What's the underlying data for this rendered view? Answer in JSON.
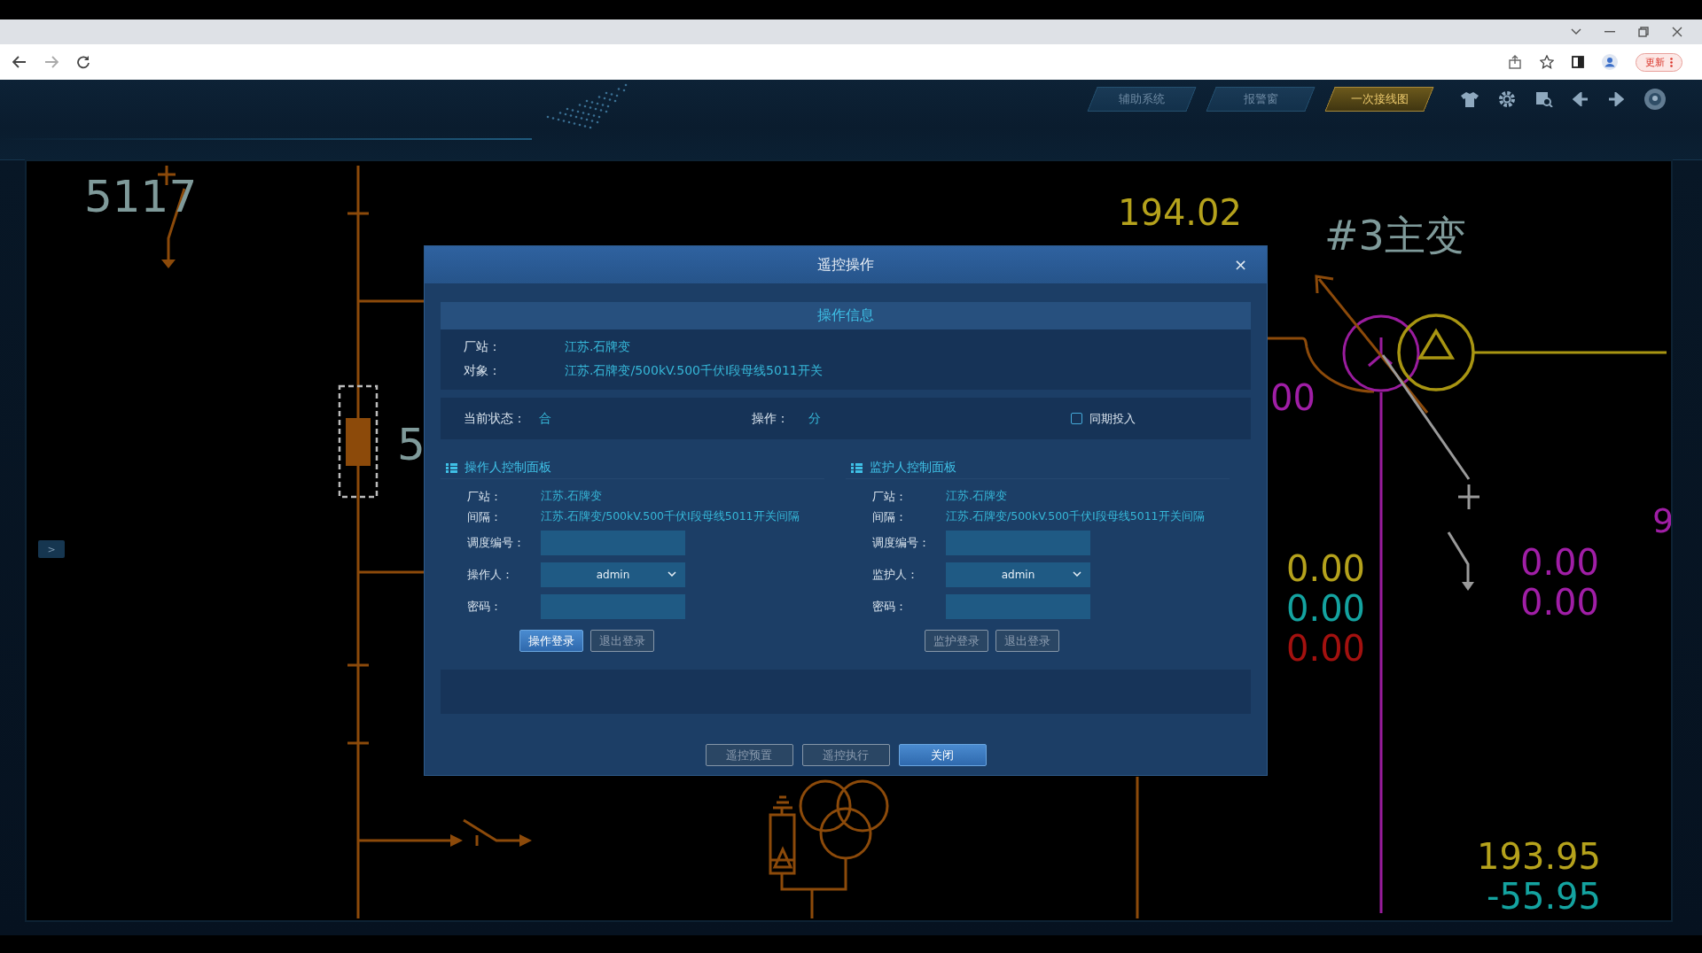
{
  "browser": {
    "update_button": "更新"
  },
  "header": {
    "tabs": [
      {
        "label": "辅助系统",
        "selected": false
      },
      {
        "label": "报警窗",
        "selected": false
      },
      {
        "label": "一次接线图",
        "selected": true
      }
    ]
  },
  "sidebar_toggle": ">",
  "diagram": {
    "labels": [
      {
        "text": "5117",
        "color": "#7f9a9a"
      },
      {
        "text": "5",
        "color": "#7f9a9a"
      },
      {
        "text": "194.02",
        "color": "#b5a21c"
      },
      {
        "text": "#3主变",
        "color": "#7f9a9a"
      },
      {
        "text": "00",
        "color": "#a01ea6"
      },
      {
        "text": "9",
        "color": "#a01ea6"
      },
      {
        "text": "0.00",
        "color": "#b5a21c"
      },
      {
        "text": "0.00",
        "color": "#14a3a0"
      },
      {
        "text": "0.00",
        "color": "#a3110f"
      },
      {
        "text": "0.00",
        "color": "#a01ea6"
      },
      {
        "text": "0.00",
        "color": "#a01ea6"
      },
      {
        "text": "193.95",
        "color": "#b5a21c"
      },
      {
        "text": "-55.95",
        "color": "#14a3a0"
      }
    ]
  },
  "dialog": {
    "title": "遥控操作",
    "close": "×",
    "info": {
      "heading": "操作信息",
      "fields": [
        {
          "label": "厂站：",
          "value": "江苏.石牌变"
        },
        {
          "label": "对象：",
          "value": "江苏.石牌变/500kV.500千伏Ⅰ段母线5011开关"
        }
      ]
    },
    "status": {
      "current_label": "当前状态：",
      "current_value": "合",
      "operation_label": "操作：",
      "operation_value": "分",
      "sync": {
        "label": "同期投入",
        "checked": false
      }
    },
    "panels": [
      {
        "title": "操作人控制面板",
        "fields": [
          {
            "kind": "text",
            "label": "厂站：",
            "value": "江苏.石牌变"
          },
          {
            "kind": "text",
            "label": "间隔：",
            "value": "江苏.石牌变/500kV.500千伏Ⅰ段母线5011开关间隔"
          },
          {
            "kind": "input",
            "label": "调度编号："
          },
          {
            "kind": "select",
            "label": "操作人：",
            "value": "admin"
          },
          {
            "kind": "input",
            "label": "密码："
          }
        ],
        "buttons": [
          {
            "label": "操作登录",
            "disabled": false
          },
          {
            "label": "退出登录",
            "disabled": true
          }
        ]
      },
      {
        "title": "监护人控制面板",
        "fields": [
          {
            "kind": "text",
            "label": "厂站：",
            "value": "江苏.石牌变"
          },
          {
            "kind": "text",
            "label": "间隔：",
            "value": "江苏.石牌变/500kV.500千伏Ⅰ段母线5011开关间隔"
          },
          {
            "kind": "input",
            "label": "调度编号："
          },
          {
            "kind": "select",
            "label": "监护人：",
            "value": "admin"
          },
          {
            "kind": "input",
            "label": "密码："
          }
        ],
        "buttons": [
          {
            "label": "监护登录",
            "disabled": true
          },
          {
            "label": "退出登录",
            "disabled": true
          }
        ]
      }
    ],
    "buttons": [
      {
        "label": "遥控预置",
        "disabled": true
      },
      {
        "label": "遥控执行",
        "disabled": true
      },
      {
        "label": "关闭",
        "disabled": false
      }
    ]
  }
}
